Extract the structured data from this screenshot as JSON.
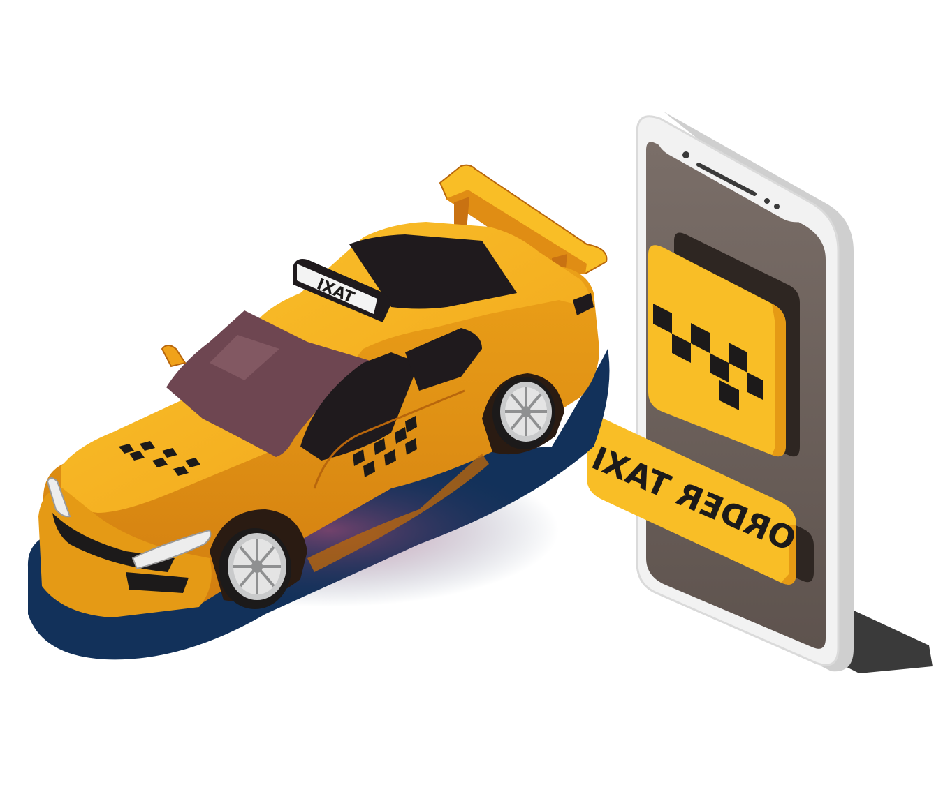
{
  "illustration": {
    "car": {
      "roof_sign_text": "TAXI"
    },
    "phone": {
      "order_button_label": "ORDER TAXI"
    }
  },
  "colors": {
    "taxi_yellow": "#F9BE26",
    "taxi_orange": "#E08D14",
    "taxi_dark_orange": "#B8660C",
    "glass_dark": "#1F1A1D",
    "windshield_purple": "#6E4651",
    "shadow_navy": "#12315A",
    "phone_screen": "#6A5E58",
    "phone_frame": "#E9E9E9",
    "checker_black": "#1C1A1A",
    "wheel_grey": "#C9CACB"
  },
  "icons": {
    "taxi_checker": "taxi-checker-icon"
  }
}
